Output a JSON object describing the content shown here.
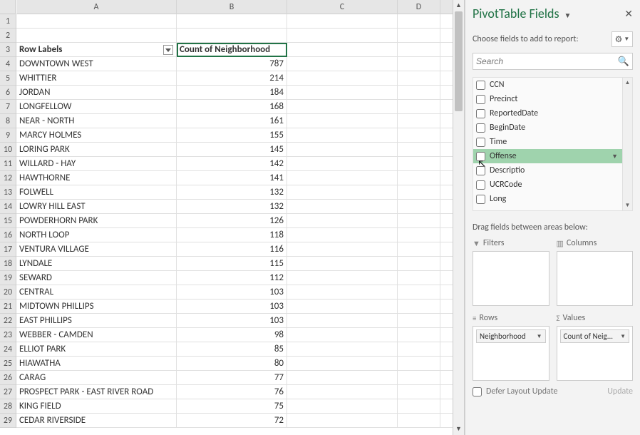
{
  "columns": [
    "A",
    "B",
    "C",
    "D"
  ],
  "header_row": {
    "a": "Row Labels",
    "b": "Count of Neighborhood"
  },
  "selected_value": "787",
  "rows": [
    {
      "n": 4,
      "label": "DOWNTOWN WEST",
      "val": "787"
    },
    {
      "n": 5,
      "label": "WHITTIER",
      "val": "214"
    },
    {
      "n": 6,
      "label": "JORDAN",
      "val": "184"
    },
    {
      "n": 7,
      "label": "LONGFELLOW",
      "val": "168"
    },
    {
      "n": 8,
      "label": "NEAR - NORTH",
      "val": "161"
    },
    {
      "n": 9,
      "label": "MARCY HOLMES",
      "val": "155"
    },
    {
      "n": 10,
      "label": "LORING PARK",
      "val": "145"
    },
    {
      "n": 11,
      "label": "WILLARD - HAY",
      "val": "142"
    },
    {
      "n": 12,
      "label": "HAWTHORNE",
      "val": "141"
    },
    {
      "n": 13,
      "label": "FOLWELL",
      "val": "132"
    },
    {
      "n": 14,
      "label": "LOWRY HILL EAST",
      "val": "132"
    },
    {
      "n": 15,
      "label": "POWDERHORN PARK",
      "val": "126"
    },
    {
      "n": 16,
      "label": "NORTH LOOP",
      "val": "118"
    },
    {
      "n": 17,
      "label": "VENTURA VILLAGE",
      "val": "116"
    },
    {
      "n": 18,
      "label": "LYNDALE",
      "val": "115"
    },
    {
      "n": 19,
      "label": "SEWARD",
      "val": "112"
    },
    {
      "n": 20,
      "label": "CENTRAL",
      "val": "103"
    },
    {
      "n": 21,
      "label": "MIDTOWN PHILLIPS",
      "val": "103"
    },
    {
      "n": 22,
      "label": "EAST PHILLIPS",
      "val": "103"
    },
    {
      "n": 23,
      "label": "WEBBER - CAMDEN",
      "val": "98"
    },
    {
      "n": 24,
      "label": "ELLIOT PARK",
      "val": "85"
    },
    {
      "n": 25,
      "label": "HIAWATHA",
      "val": "80"
    },
    {
      "n": 26,
      "label": "CARAG",
      "val": "77"
    },
    {
      "n": 27,
      "label": "PROSPECT PARK - EAST RIVER ROAD",
      "val": "76"
    },
    {
      "n": 28,
      "label": "KING FIELD",
      "val": "75"
    },
    {
      "n": 29,
      "label": "CEDAR RIVERSIDE",
      "val": "72"
    }
  ],
  "pane": {
    "title": "PivotTable Fields",
    "subtitle": "Choose fields to add to report:",
    "search_placeholder": "Search",
    "drag_label": "Drag fields between areas below:",
    "fields": [
      {
        "name": "CCN",
        "highlight": false
      },
      {
        "name": "Precinct",
        "highlight": false
      },
      {
        "name": "ReportedDate",
        "highlight": false
      },
      {
        "name": "BeginDate",
        "highlight": false
      },
      {
        "name": "Time",
        "highlight": false
      },
      {
        "name": "Offense",
        "highlight": true
      },
      {
        "name": "Descriptio",
        "highlight": false
      },
      {
        "name": "UCRCode",
        "highlight": false
      },
      {
        "name": "Long",
        "highlight": false
      }
    ],
    "zones": {
      "filters": "Filters",
      "columns": "Columns",
      "rows": "Rows",
      "values": "Values"
    },
    "pills": {
      "rows": "Neighborhood",
      "values": "Count of Neig..."
    },
    "defer_label": "Defer Layout Update",
    "update_label": "Update"
  }
}
